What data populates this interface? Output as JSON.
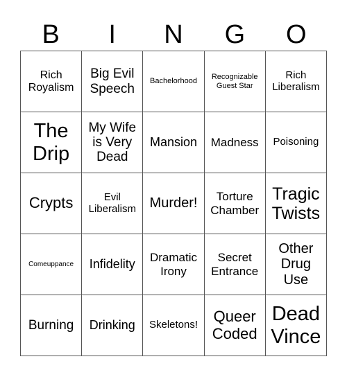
{
  "header": {
    "letters": [
      "B",
      "I",
      "N",
      "G",
      "O"
    ]
  },
  "board": {
    "rows": [
      [
        "Rich Royalism",
        "Big Evil Speech",
        "Bachelorhood",
        "Recognizable Guest Star",
        "Rich Liberalism"
      ],
      [
        "The Drip",
        "My Wife is Very Dead",
        "Mansion",
        "Madness",
        "Poisoning"
      ],
      [
        "Crypts",
        "Evil Liberalism",
        "Murder!",
        "Torture Chamber",
        "Tragic Twists"
      ],
      [
        "Comeuppance",
        "Infidelity",
        "Dramatic Irony",
        "Secret Entrance",
        "Other Drug Use"
      ],
      [
        "Burning",
        "Drinking",
        "Skeletons!",
        "Queer Coded",
        "Dead Vince"
      ]
    ]
  }
}
